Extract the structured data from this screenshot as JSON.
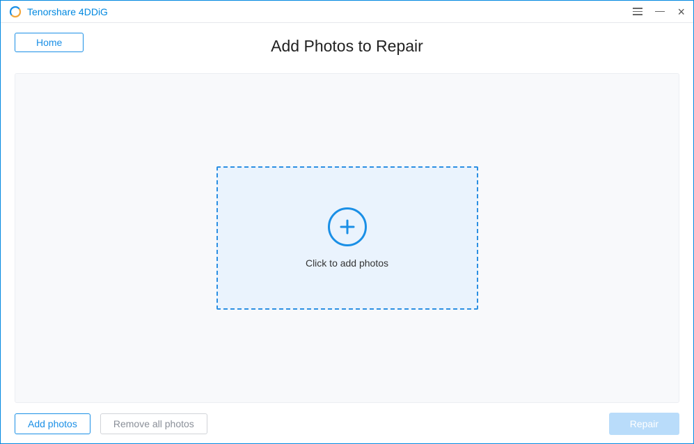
{
  "app": {
    "title": "Tenorshare 4DDiG"
  },
  "header": {
    "home_label": "Home",
    "page_title": "Add Photos to Repair"
  },
  "dropzone": {
    "text": "Click to add photos"
  },
  "footer": {
    "add_photos_label": "Add photos",
    "remove_all_label": "Remove all photos",
    "repair_label": "Repair"
  }
}
